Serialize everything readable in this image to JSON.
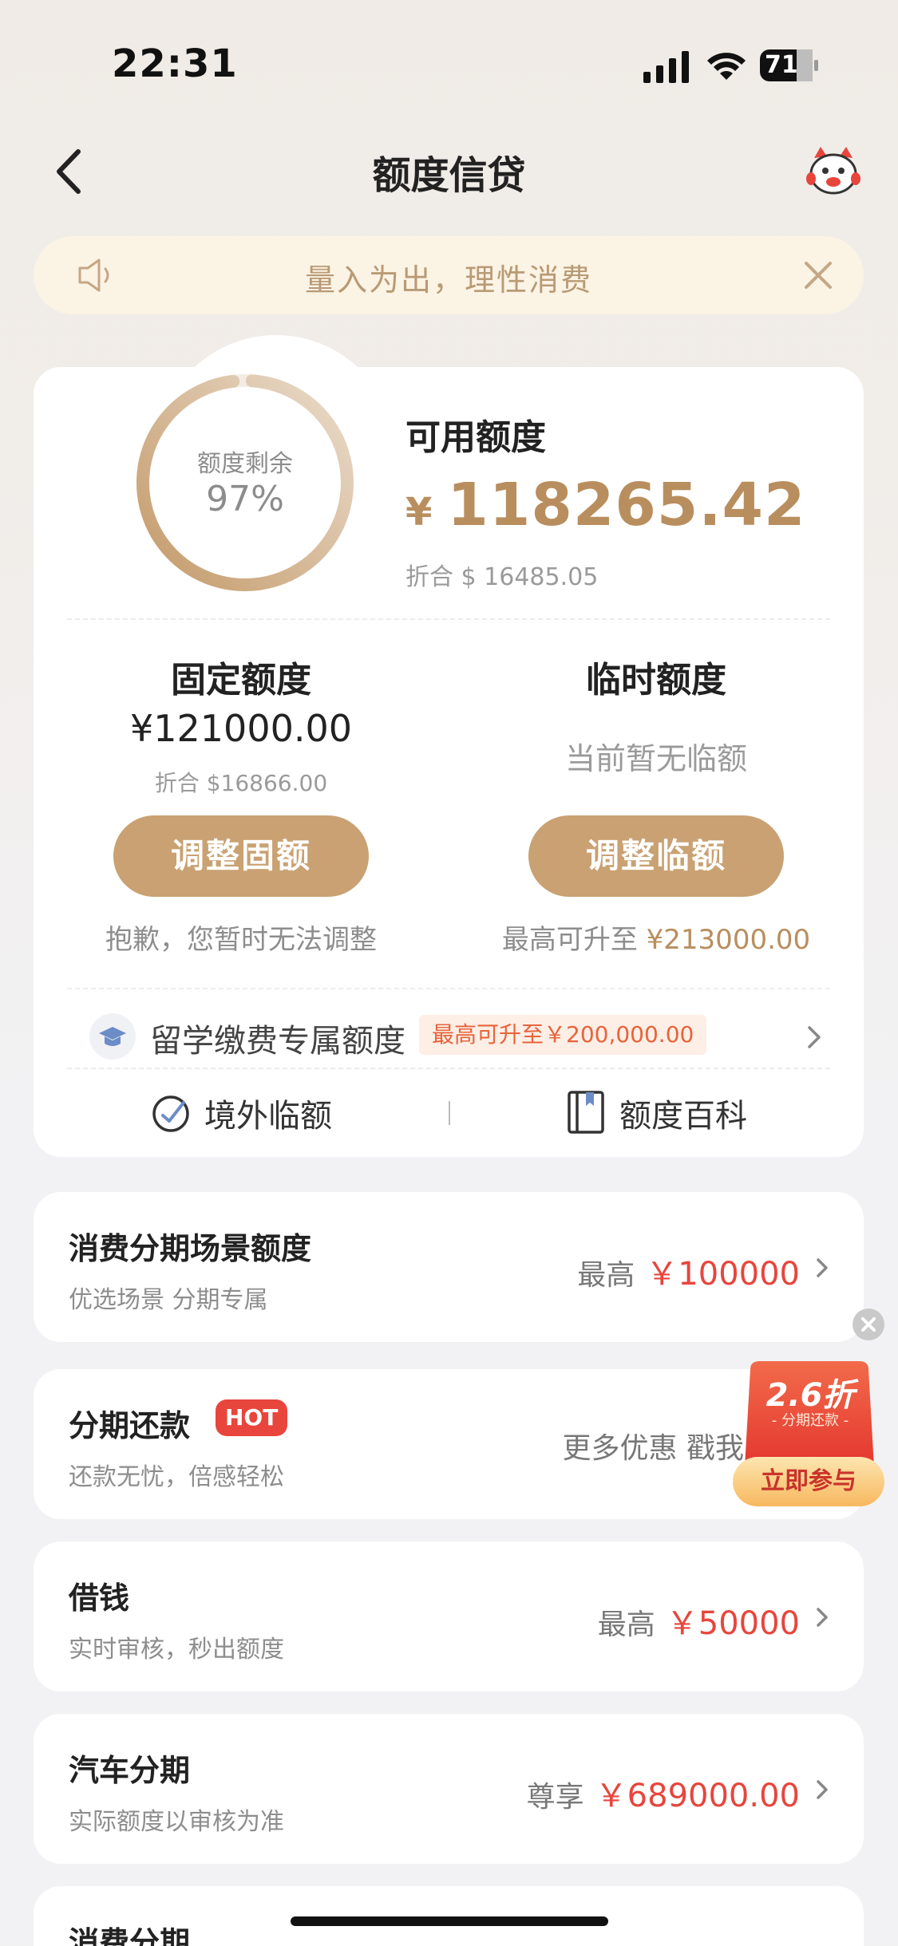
{
  "status_bar": {
    "time": "22:31",
    "battery": "71"
  },
  "nav": {
    "title": "额度信贷"
  },
  "notice": {
    "text": "量入为出，理性消费"
  },
  "credit": {
    "ring_label": "额度剩余",
    "ring_percent": "97%",
    "ring_fraction": 0.97,
    "available_label": "可用额度",
    "available_currency": "¥",
    "available_amount": "118265.42",
    "available_converted": "折合 $ 16485.05",
    "fixed": {
      "title": "固定额度",
      "amount": "¥121000.00",
      "converted": "折合 $16866.00",
      "button": "调整固额",
      "note": "抱歉，您暂时无法调整"
    },
    "temporary": {
      "title": "临时额度",
      "status": "当前暂无临额",
      "button": "调整临额",
      "note_prefix": "最高可升至",
      "note_amount": "¥213000.00"
    },
    "study_abroad": {
      "label": "留学缴费专属额度",
      "badge": "最高可升至￥200,000.00"
    },
    "links": {
      "overseas": "境外临额",
      "encyclopedia": "额度百科"
    }
  },
  "list": [
    {
      "title": "消费分期场景额度",
      "subtitle": "优选场景 分期专属",
      "right_prefix": "最高",
      "right_value": "￥100000"
    },
    {
      "title": "分期还款",
      "badge": "HOT",
      "subtitle": "还款无忧，倍感轻松",
      "right_prefix": "更多优惠 戳我"
    },
    {
      "title": "借钱",
      "subtitle": "实时审核，秒出额度",
      "right_prefix": "最高",
      "right_value": "￥50000"
    },
    {
      "title": "汽车分期",
      "subtitle": "实际额度以审核为准",
      "right_prefix": "尊享",
      "right_value": "￥689000.00"
    },
    {
      "title": "消费分期"
    }
  ],
  "promo": {
    "discount": "2.6折",
    "tag": "- 分期还款 -",
    "button": "立即参与"
  },
  "colors": {
    "gold": "#c9a172",
    "red": "#e8453c",
    "notice_bg": "#fbf3e4"
  }
}
